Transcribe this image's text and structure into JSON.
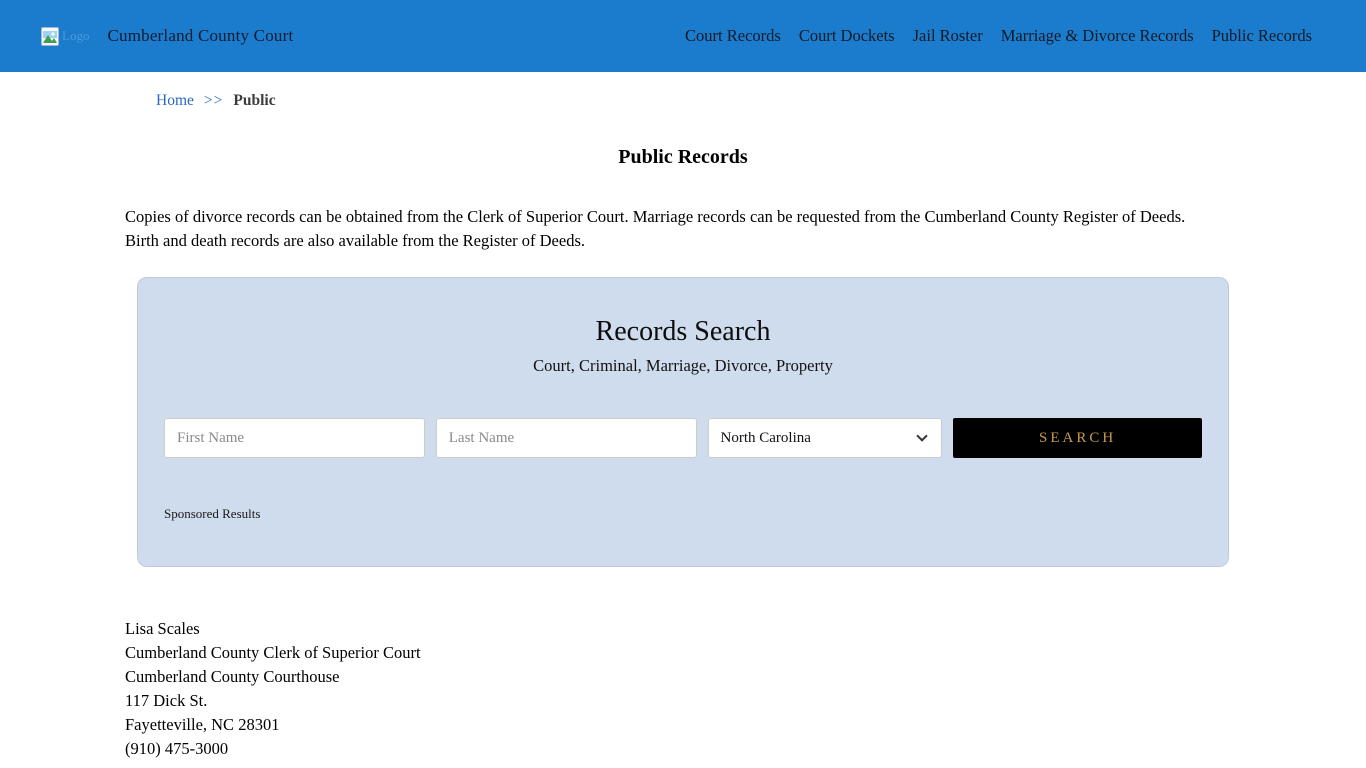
{
  "header": {
    "logo_alt": "Logo",
    "site_title": "Cumberland County Court",
    "nav": [
      {
        "label": "Court Records"
      },
      {
        "label": "Court Dockets"
      },
      {
        "label": "Jail Roster"
      },
      {
        "label": "Marriage & Divorce Records"
      },
      {
        "label": "Public Records"
      }
    ]
  },
  "breadcrumb": {
    "home": "Home",
    "separator": ">>",
    "current": "Public"
  },
  "page": {
    "title": "Public Records",
    "intro": "Copies of divorce records can be obtained from the Clerk of Superior Court. Marriage records can be requested from the Cumberland County Register of Deeds. Birth and death records are also available from the Register of Deeds."
  },
  "search_panel": {
    "title": "Records Search",
    "subtitle": "Court, Criminal, Marriage, Divorce, Property",
    "first_name_placeholder": "First Name",
    "last_name_placeholder": "Last Name",
    "state_selected": "North Carolina",
    "search_label": "SEARCH",
    "sponsored_label": "Sponsored Results"
  },
  "contact": {
    "lines": [
      "Lisa Scales",
      "Cumberland County Clerk of Superior Court",
      "Cumberland County Courthouse",
      "117 Dick St.",
      "Fayetteville, NC 28301",
      "(910) 475-3000"
    ]
  },
  "colors": {
    "header_bg": "#1b7ccd",
    "panel_bg": "#cfdcee",
    "button_bg": "#000000",
    "button_text": "#c99a4e",
    "link": "#2b66c2"
  }
}
